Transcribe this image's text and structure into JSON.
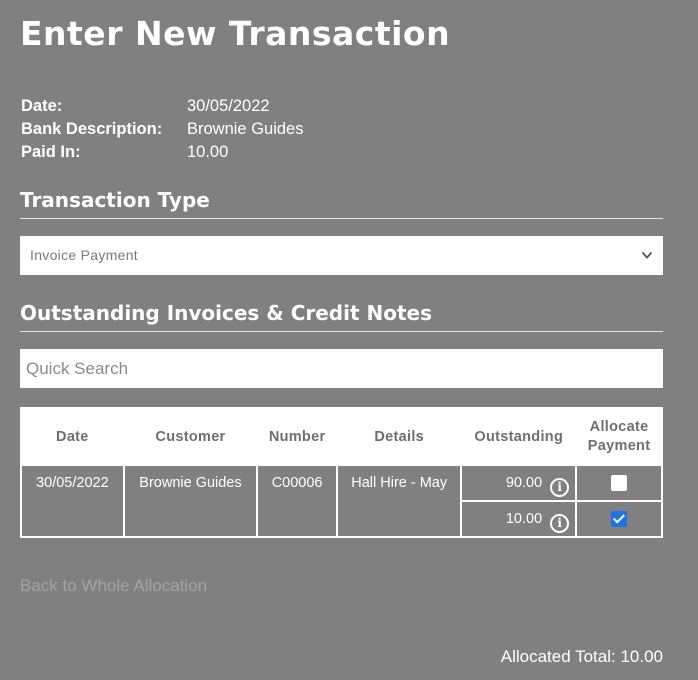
{
  "page": {
    "title": "Enter New Transaction"
  },
  "transaction": {
    "date_label": "Date:",
    "date_value": "30/05/2022",
    "desc_label": "Bank Description:",
    "desc_value": "Brownie Guides",
    "paid_label": "Paid In:",
    "paid_value": "10.00"
  },
  "transaction_type": {
    "heading": "Transaction Type",
    "selected": "Invoice Payment",
    "icon": "chevron-down-icon"
  },
  "outstanding": {
    "heading": "Outstanding Invoices & Credit Notes",
    "search_placeholder": "Quick Search",
    "columns": {
      "date": "Date",
      "customer": "Customer",
      "number": "Number",
      "details": "Details",
      "outstanding": "Outstanding",
      "allocate_line1": "Allocate",
      "allocate_line2": "Payment"
    },
    "row": {
      "date": "30/05/2022",
      "customer": "Brownie Guides",
      "number": "C00006",
      "details": "Hall Hire - May",
      "lines": [
        {
          "outstanding": "90.00",
          "checked": false
        },
        {
          "outstanding": "10.00",
          "checked": true
        }
      ]
    },
    "info_icon": "i"
  },
  "footer": {
    "back_link": "Back to Whole Allocation",
    "allocated_total": "Allocated Total: 10.00"
  },
  "colors": {
    "background": "#808080",
    "checkbox_checked": "#1a73e8",
    "link_muted": "#a4a4a4"
  }
}
